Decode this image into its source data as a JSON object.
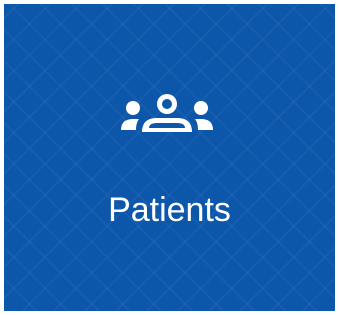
{
  "tile": {
    "label": "Patients",
    "icon": "patients-group-icon",
    "background_color": "#0d57ab",
    "text_color": "#ffffff"
  }
}
